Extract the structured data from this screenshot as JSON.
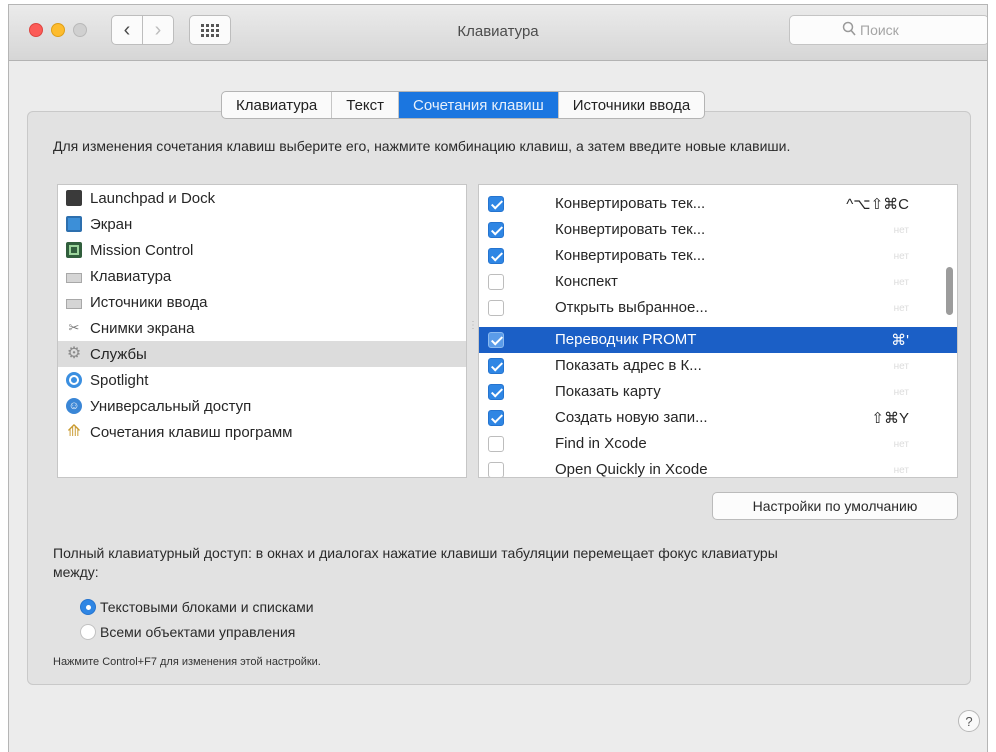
{
  "window": {
    "title": "Клавиатура"
  },
  "toolbar": {
    "back_label": "‹",
    "forward_label": "›",
    "search_placeholder": "Поиск"
  },
  "tabs": [
    {
      "label": "Клавиатура",
      "active": false
    },
    {
      "label": "Текст",
      "active": false
    },
    {
      "label": "Сочетания клавиш",
      "active": true
    },
    {
      "label": "Источники ввода",
      "active": false
    }
  ],
  "instructions": "Для изменения сочетания клавиш выберите его, нажмите комбинацию клавиш, а затем введите новые клавиши.",
  "categories": [
    {
      "label": "Launchpad и Dock",
      "icon": "dock-icon"
    },
    {
      "label": "Экран",
      "icon": "display-icon"
    },
    {
      "label": "Mission Control",
      "icon": "mission-control-icon"
    },
    {
      "label": "Клавиатура",
      "icon": "keyboard-icon"
    },
    {
      "label": "Источники ввода",
      "icon": "keyboard-icon"
    },
    {
      "label": "Снимки экрана",
      "icon": "screenshot-icon"
    },
    {
      "label": "Службы",
      "icon": "gear-icon",
      "selected": true
    },
    {
      "label": "Spotlight",
      "icon": "spotlight-icon"
    },
    {
      "label": "Универсальный доступ",
      "icon": "accessibility-icon"
    },
    {
      "label": "Сочетания клавиш программ",
      "icon": "app-shortcuts-icon"
    }
  ],
  "shortcuts": [
    {
      "label": "Конвертировать тек...",
      "checked": true,
      "key": "^⌥⇧⌘C"
    },
    {
      "label": "Конвертировать тек...",
      "checked": true,
      "key": "нет"
    },
    {
      "label": "Конвертировать тек...",
      "checked": true,
      "key": "нет"
    },
    {
      "label": "Конспект",
      "checked": false,
      "key": "нет"
    },
    {
      "label": "Открыть выбранное...",
      "checked": false,
      "key": "нет"
    },
    {
      "label": "Переводчик PROMT",
      "checked": true,
      "key": "⌘'",
      "selected": true
    },
    {
      "label": "Показать адрес в К...",
      "checked": true,
      "key": "нет"
    },
    {
      "label": "Показать карту",
      "checked": true,
      "key": "нет"
    },
    {
      "label": "Создать новую запи...",
      "checked": true,
      "key": "⇧⌘Y"
    },
    {
      "label": "Find in Xcode",
      "checked": false,
      "key": "нет"
    },
    {
      "label": "Open Quickly in Xcode",
      "checked": false,
      "key": "нет"
    }
  ],
  "defaults_button": "Настройки по умолчанию",
  "full_access": {
    "text": "Полный клавиатурный доступ: в окнах и диалогах нажатие клавиши табуляции перемещает фокус клавиатуры между:",
    "options": [
      {
        "label": "Текстовыми блоками и списками",
        "selected": true
      },
      {
        "label": "Всеми объектами управления",
        "selected": false
      }
    ],
    "hint": "Нажмите Control+F7 для изменения этой настройки."
  },
  "help_label": "?",
  "colors": {
    "accent": "#1b76e0",
    "selection": "#1b5fc6",
    "close": "#fc5b57",
    "minimize": "#fdbc2e"
  }
}
